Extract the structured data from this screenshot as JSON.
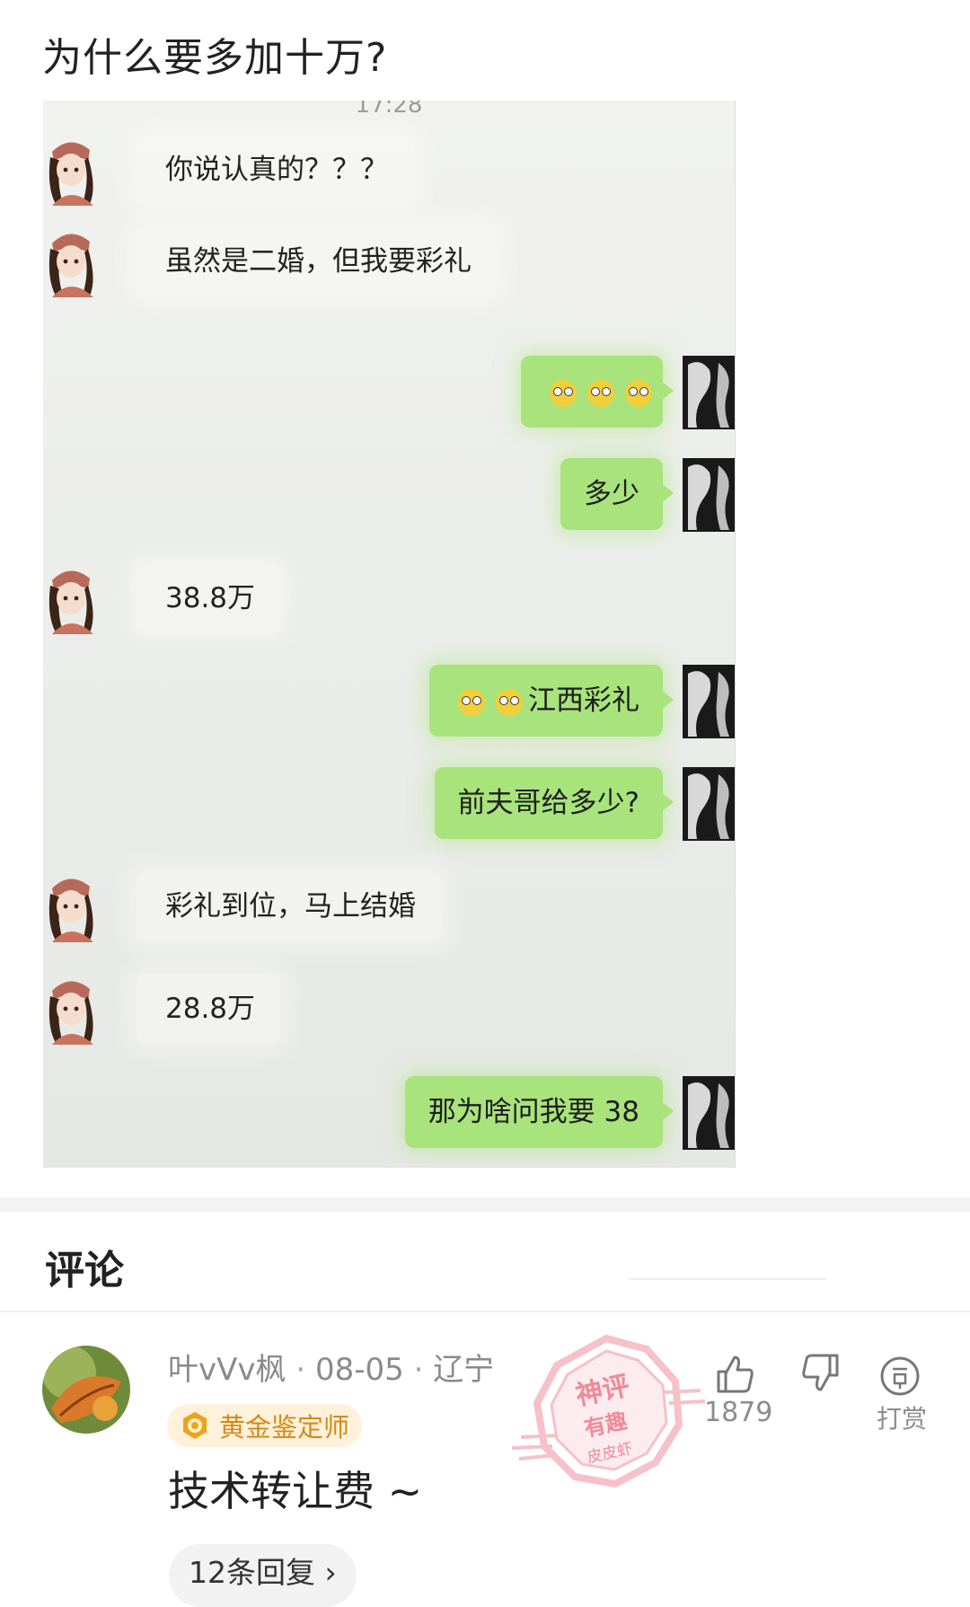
{
  "post": {
    "title": "为什么要多加十万?"
  },
  "chat": {
    "time": "17:28",
    "messages": [
      {
        "side": "in",
        "text": "你说认真的？？？"
      },
      {
        "side": "in",
        "text": "虽然是二婚，但我要彩礼"
      },
      {
        "side": "out",
        "emoji": "thinking-eyes x3",
        "text": ""
      },
      {
        "side": "out",
        "text": "多少"
      },
      {
        "side": "in",
        "text": "38.8万"
      },
      {
        "side": "out",
        "emoji": "facepalm x2",
        "text": "江西彩礼"
      },
      {
        "side": "out",
        "text": "前夫哥给多少?"
      },
      {
        "side": "in",
        "text": "彩礼到位，马上结婚"
      },
      {
        "side": "in",
        "text": "28.8万"
      },
      {
        "side": "out",
        "text": "那为啥问我要 38"
      }
    ]
  },
  "comments": {
    "heading": "评论",
    "items": [
      {
        "user": "叶vVv枫",
        "date": "08-05",
        "location": "辽宁",
        "badge": "黄金鉴定师",
        "text": "技术转让费 ~",
        "replies": "12条回复",
        "likes": "1879",
        "tip_label": "打赏",
        "stamp_lines": [
          "神评",
          "有趣",
          "皮皮虾"
        ]
      }
    ]
  },
  "colors": {
    "bubble_out": "#a8e37c",
    "badge_bg": "#fff1da",
    "badge_text": "#d48a18",
    "stamp": "#f2a0ab"
  }
}
